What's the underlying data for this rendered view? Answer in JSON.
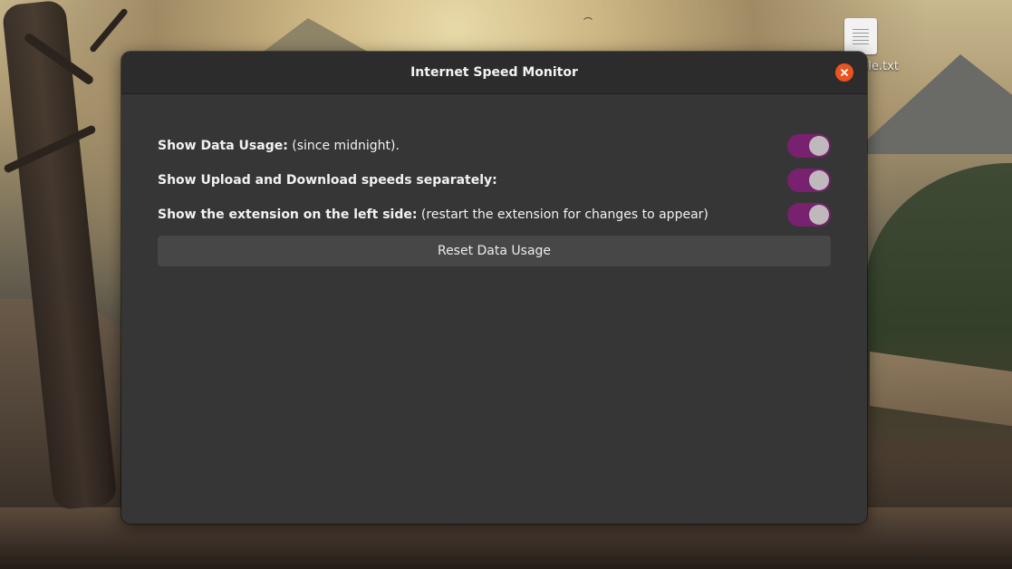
{
  "desktop": {
    "icon_label": "ble.txt",
    "icon_name": "text-file-icon"
  },
  "window": {
    "title": "Internet Speed Monitor",
    "close_icon": "close-icon",
    "accent_color": "#e95420"
  },
  "settings": [
    {
      "label_bold": "Show Data Usage:",
      "label_rest": " (since midnight).",
      "enabled": true
    },
    {
      "label_bold": "Show Upload and Download speeds separately:",
      "label_rest": "",
      "enabled": true
    },
    {
      "label_bold": "Show the extension on the left side:",
      "label_rest": " (restart the extension for changes to appear)",
      "enabled": true
    }
  ],
  "toggle_color": "#77216f",
  "reset_button": {
    "label": "Reset Data Usage"
  }
}
